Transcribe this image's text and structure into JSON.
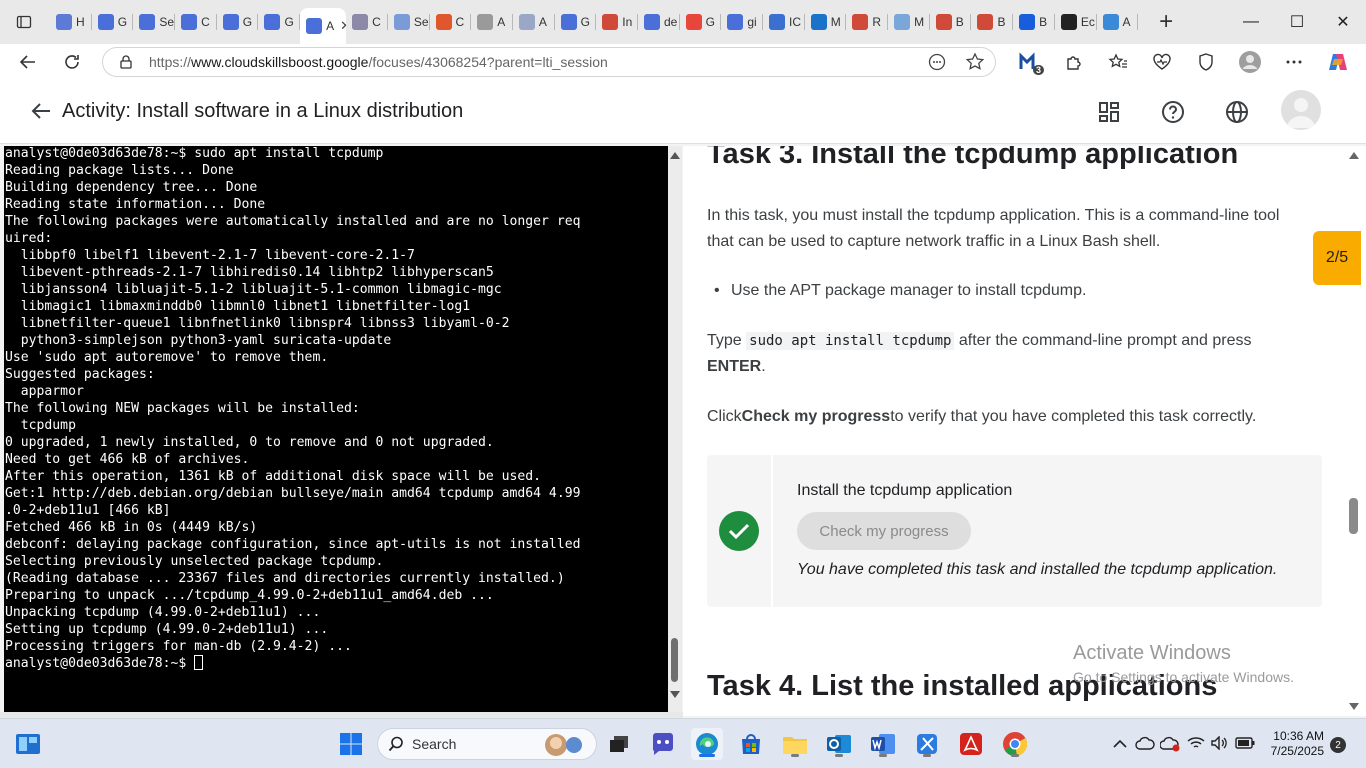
{
  "browser": {
    "tabs": [
      {
        "label": "H",
        "icon": "cloud-icon",
        "color": "#5b7bd5"
      },
      {
        "label": "G",
        "icon": "google-icon",
        "color": "#4a6fd8"
      },
      {
        "label": "Se",
        "icon": "google-icon",
        "color": "#4a6fd8"
      },
      {
        "label": "C",
        "icon": "docs-icon",
        "color": "#4a6fd8"
      },
      {
        "label": "G",
        "icon": "google-icon",
        "color": "#4a6fd8"
      },
      {
        "label": "G",
        "icon": "google-icon",
        "color": "#4a6fd8"
      },
      {
        "label": "A",
        "icon": "google-icon",
        "color": "#4a6fd8",
        "active": true
      },
      {
        "label": "C",
        "icon": "cloud-icon",
        "color": "#8a8aa8"
      },
      {
        "label": "Se",
        "icon": "cloud-icon",
        "color": "#7a9bd8"
      },
      {
        "label": "C",
        "icon": "gear-icon",
        "color": "#e0562d"
      },
      {
        "label": "A",
        "icon": "apple-icon",
        "color": "#9a9a9a"
      },
      {
        "label": "A",
        "icon": "shield-icon",
        "color": "#9aa7c7"
      },
      {
        "label": "G",
        "icon": "vpn-icon",
        "color": "#4a6fd8"
      },
      {
        "label": "In",
        "icon": "gmail-icon",
        "color": "#d04a3a"
      },
      {
        "label": "de",
        "icon": "search-icon",
        "color": "#4a6fd8"
      },
      {
        "label": "G",
        "icon": "google-icon",
        "color": "#e8453c"
      },
      {
        "label": "gi",
        "icon": "search-icon",
        "color": "#4a6fd8"
      },
      {
        "label": "IC",
        "icon": "contact-icon",
        "color": "#3b6fd0"
      },
      {
        "label": "M",
        "icon": "outlook-icon",
        "color": "#1a73c8"
      },
      {
        "label": "R",
        "icon": "pdf-icon",
        "color": "#d04a3a"
      },
      {
        "label": "M",
        "icon": "cloud-icon",
        "color": "#7aa7d8"
      },
      {
        "label": "B",
        "icon": "pdf-icon",
        "color": "#d04a3a"
      },
      {
        "label": "B",
        "icon": "pdf-icon",
        "color": "#d04a3a"
      },
      {
        "label": "B",
        "icon": "bitwarden-icon",
        "color": "#175ddc"
      },
      {
        "label": "Ec",
        "icon": "github-icon",
        "color": "#222222"
      },
      {
        "label": "A",
        "icon": "app-icon",
        "color": "#3b8ad8"
      }
    ],
    "tab_close": "✕",
    "new_tab": "+",
    "url_prefix": "https://",
    "url_domain": "www.cloudskillsboost.google",
    "url_path": "/focuses/43068254?parent=lti_session",
    "ext_badge": "3"
  },
  "header": {
    "title": "Activity: Install software in a Linux distribution"
  },
  "terminal": {
    "lines": [
      "analyst@0de03d63de78:~$ sudo apt install tcpdump",
      "Reading package lists... Done",
      "Building dependency tree... Done",
      "Reading state information... Done",
      "The following packages were automatically installed and are no longer req",
      "uired:",
      "  libbpf0 libelf1 libevent-2.1-7 libevent-core-2.1-7",
      "  libevent-pthreads-2.1-7 libhiredis0.14 libhtp2 libhyperscan5",
      "  libjansson4 libluajit-5.1-2 libluajit-5.1-common libmagic-mgc",
      "  libmagic1 libmaxminddb0 libmnl0 libnet1 libnetfilter-log1",
      "  libnetfilter-queue1 libnfnetlink0 libnspr4 libnss3 libyaml-0-2",
      "  python3-simplejson python3-yaml suricata-update",
      "Use 'sudo apt autoremove' to remove them.",
      "Suggested packages:",
      "  apparmor",
      "The following NEW packages will be installed:",
      "  tcpdump",
      "0 upgraded, 1 newly installed, 0 to remove and 0 not upgraded.",
      "Need to get 466 kB of archives.",
      "After this operation, 1361 kB of additional disk space will be used.",
      "Get:1 http://deb.debian.org/debian bullseye/main amd64 tcpdump amd64 4.99",
      ".0-2+deb11u1 [466 kB]",
      "Fetched 466 kB in 0s (4449 kB/s)",
      "debconf: delaying package configuration, since apt-utils is not installed",
      "Selecting previously unselected package tcpdump.",
      "(Reading database ... 23367 files and directories currently installed.)",
      "Preparing to unpack .../tcpdump_4.99.0-2+deb11u1_amd64.deb ...",
      "Unpacking tcpdump (4.99.0-2+deb11u1) ...",
      "Setting up tcpdump (4.99.0-2+deb11u1) ...",
      "Processing triggers for man-db (2.9.4-2) ..."
    ],
    "prompt": "analyst@0de03d63de78:~$ "
  },
  "instructions": {
    "task3_heading": "Task 3. Install the tcpdump application",
    "para1": "In this task, you must install the tcpdump application. This is a command-line tool that can be used to capture network traffic in a Linux Bash shell.",
    "bullet1": "Use the APT package manager to install tcpdump.",
    "type_prefix": "Type",
    "type_code": "sudo apt install tcpdump",
    "type_suffix": "after the command-line prompt and press",
    "enter_key": "ENTER",
    "enter_period": ".",
    "click_prefix": "Click",
    "click_bold": "Check my progress",
    "click_suffix": "to verify that you have completed this task correctly.",
    "check_title": "Install the tcpdump application",
    "check_button": "Check my progress",
    "check_message": "You have completed this task and installed the tcpdump application.",
    "task4_heading": "Task 4. List the installed applications",
    "progress": "2/5"
  },
  "watermark": {
    "line1": "Activate Windows",
    "line2": "Go to Settings to activate Windows."
  },
  "taskbar": {
    "search_label": "Search",
    "time": "10:36 AM",
    "date": "7/25/2025",
    "notifications": "2"
  }
}
